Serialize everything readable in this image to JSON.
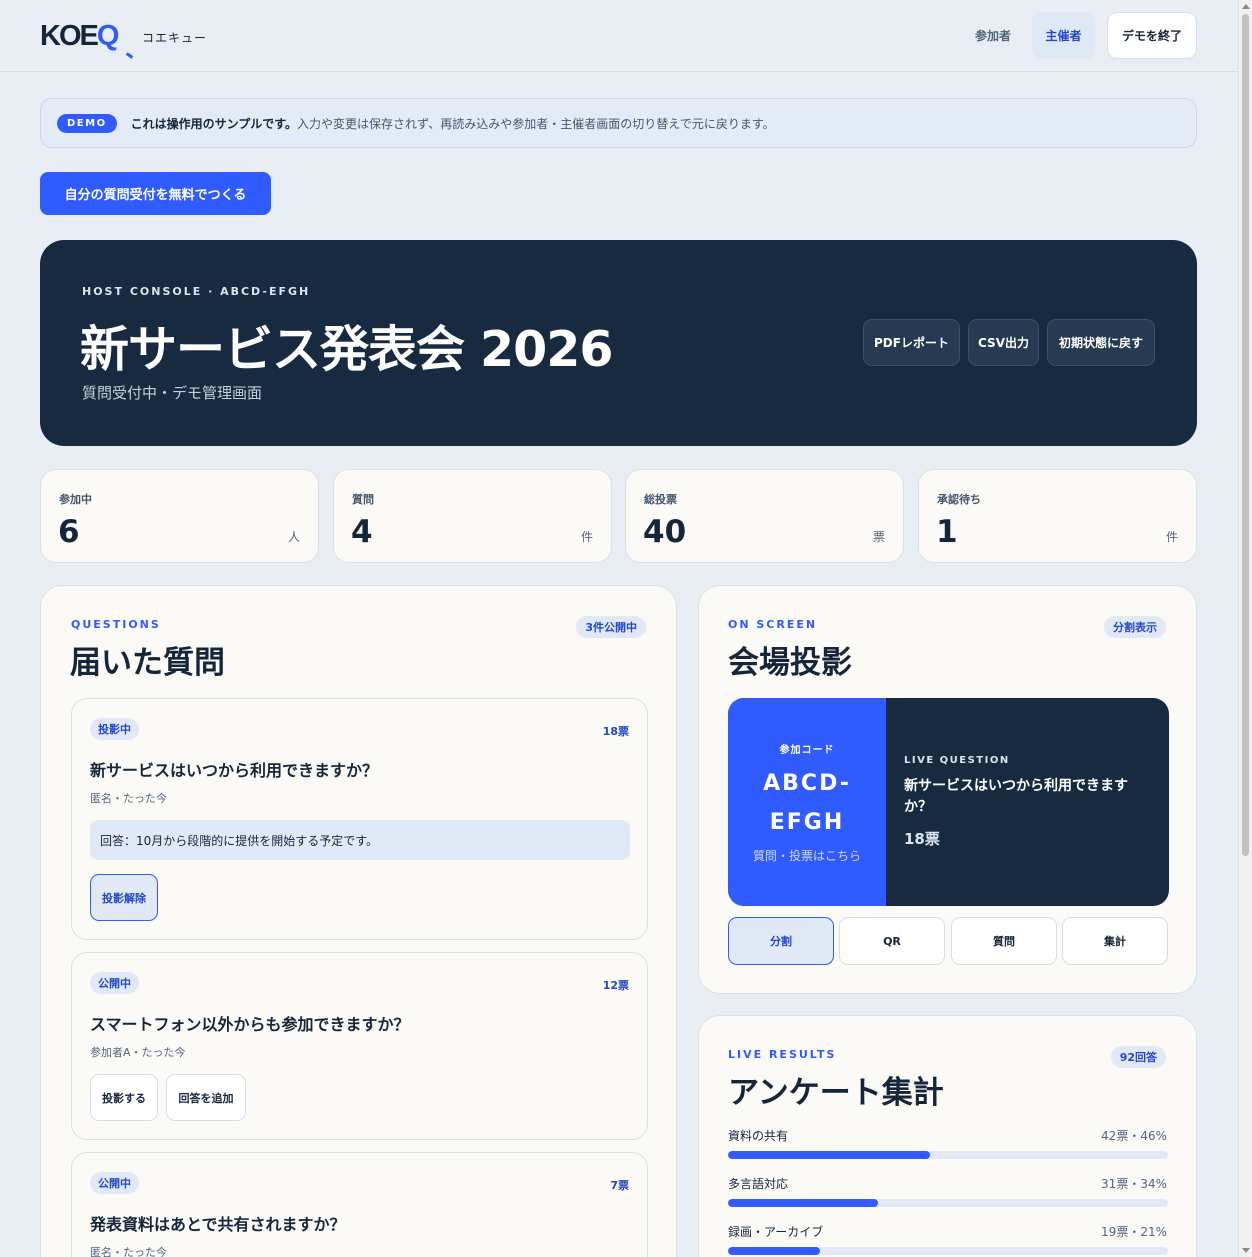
{
  "header": {
    "logo": "KOEQ",
    "logo_sub": "コエキュー",
    "nav_participant": "参加者",
    "nav_host": "主催者",
    "nav_exit": "デモを終了"
  },
  "banner": {
    "badge": "DEMO",
    "strong": "これは操作用のサンプルです。",
    "text": "入力や変更は保存されず、再読み込みや参加者・主催者画面の切り替えで元に戻ります。"
  },
  "cta_label": "自分の質問受付を無料でつくる",
  "hero": {
    "eyebrow": "HOST CONSOLE · ABCD-EFGH",
    "title": "新サービス発表会 2026",
    "subtitle": "質問受付中・デモ管理画面",
    "buttons": [
      "PDFレポート",
      "CSV出力",
      "初期状態に戻す"
    ]
  },
  "stats": [
    {
      "label": "参加中",
      "value": "6",
      "unit": "人"
    },
    {
      "label": "質問",
      "value": "4",
      "unit": "件"
    },
    {
      "label": "総投票",
      "value": "40",
      "unit": "票"
    },
    {
      "label": "承認待ち",
      "value": "1",
      "unit": "件"
    }
  ],
  "questions": {
    "eyebrow": "QUESTIONS",
    "title": "届いた質問",
    "badge": "3件公開中",
    "items": [
      {
        "status": "投影中",
        "votes": "18票",
        "text": "新サービスはいつから利用できますか？",
        "meta": "匿名・たった今",
        "answer": "回答：10月から段階的に提供を開始する予定です。",
        "buttons": [
          "投影解除"
        ]
      },
      {
        "status": "公開中",
        "votes": "12票",
        "text": "スマートフォン以外からも参加できますか？",
        "meta": "参加者A・たった今",
        "buttons": [
          "投影する",
          "回答を追加"
        ]
      },
      {
        "status": "公開中",
        "votes": "7票",
        "text": "発表資料はあとで共有されますか？",
        "meta": "匿名・たった今"
      }
    ]
  },
  "onscreen": {
    "eyebrow": "ON SCREEN",
    "title": "会場投影",
    "badge": "分割表示",
    "code_label": "参加コード",
    "code_value": "ABCD-EFGH",
    "code_note": "質問・投票はこちら",
    "live_label": "LIVE QUESTION",
    "live_question": "新サービスはいつから利用できますか？",
    "live_votes": "18票",
    "modes": [
      "分割",
      "QR",
      "質問",
      "集計"
    ],
    "active_mode": 0
  },
  "results": {
    "eyebrow": "LIVE RESULTS",
    "title": "アンケート集計",
    "badge": "92回答",
    "items": [
      {
        "label": "資料の共有",
        "value": "42票・46%",
        "percent": 46
      },
      {
        "label": "多言語対応",
        "value": "31票・34%",
        "percent": 34
      },
      {
        "label": "録画・アーカイブ",
        "value": "19票・21%",
        "percent": 21
      }
    ]
  },
  "colors": {
    "accent": "#2f5bff",
    "navy": "#172a40",
    "background": "#e9eef4",
    "card": "#fbfaf7"
  }
}
